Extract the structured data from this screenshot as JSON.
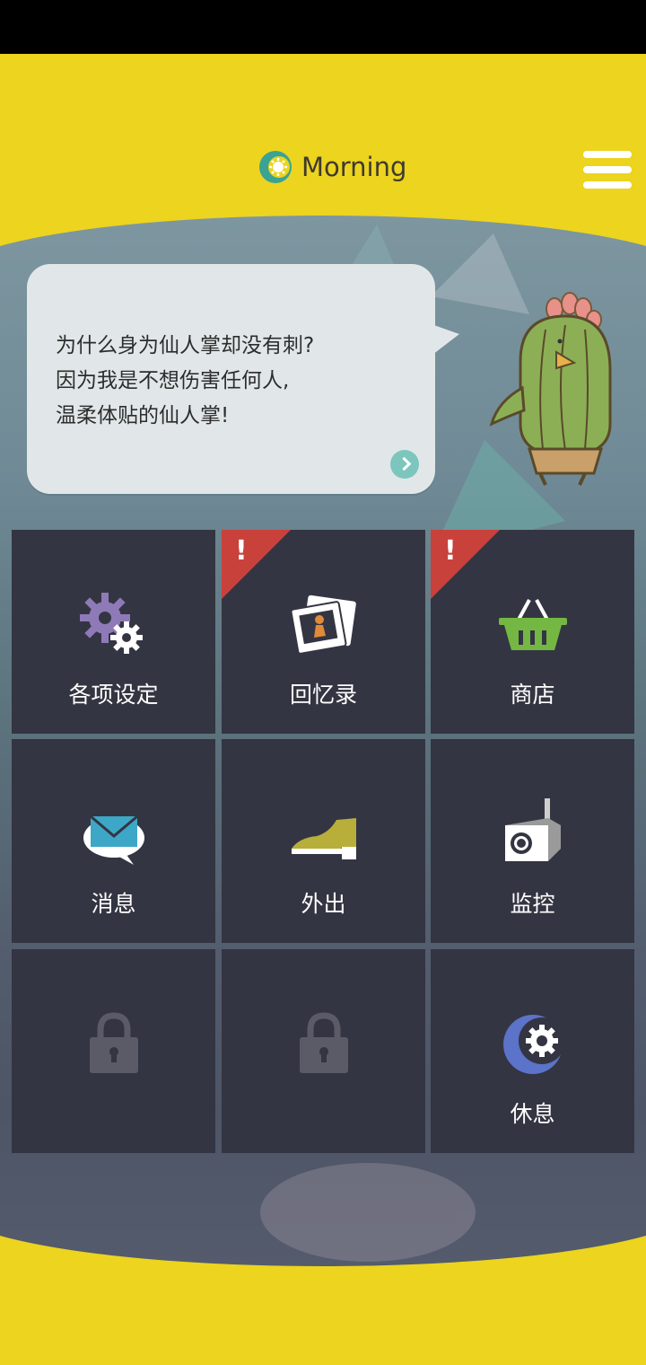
{
  "header": {
    "time_label": "Morning",
    "time_icon": "day-night-cycle-icon",
    "menu_icon": "hamburger-menu-icon"
  },
  "speech": {
    "lines": [
      "为什么身为仙人掌却没有刺?",
      "因为我是不想伤害任何人,",
      "温柔体贴的仙人掌!"
    ],
    "next_icon": "chevron-right-icon"
  },
  "menu": {
    "tiles": [
      {
        "label": "各项设定",
        "icon": "gears-icon",
        "alert": false
      },
      {
        "label": "回忆录",
        "icon": "photos-icon",
        "alert": true
      },
      {
        "label": "商店",
        "icon": "shopping-basket-icon",
        "alert": true
      },
      {
        "label": "消息",
        "icon": "mail-bubble-icon",
        "alert": false
      },
      {
        "label": "外出",
        "icon": "shoe-icon",
        "alert": false
      },
      {
        "label": "监控",
        "icon": "camera-icon",
        "alert": false
      },
      {
        "label": "",
        "icon": "lock-icon",
        "alert": false
      },
      {
        "label": "",
        "icon": "lock-icon",
        "alert": false
      },
      {
        "label": "休息",
        "icon": "moon-gear-icon",
        "alert": false
      }
    ],
    "alert_mark": "!"
  },
  "colors": {
    "frame_yellow": "#ecd41f",
    "tile_bg": "#343542",
    "alert_red": "#c9413b",
    "accent_teal": "#7cc6bd"
  }
}
